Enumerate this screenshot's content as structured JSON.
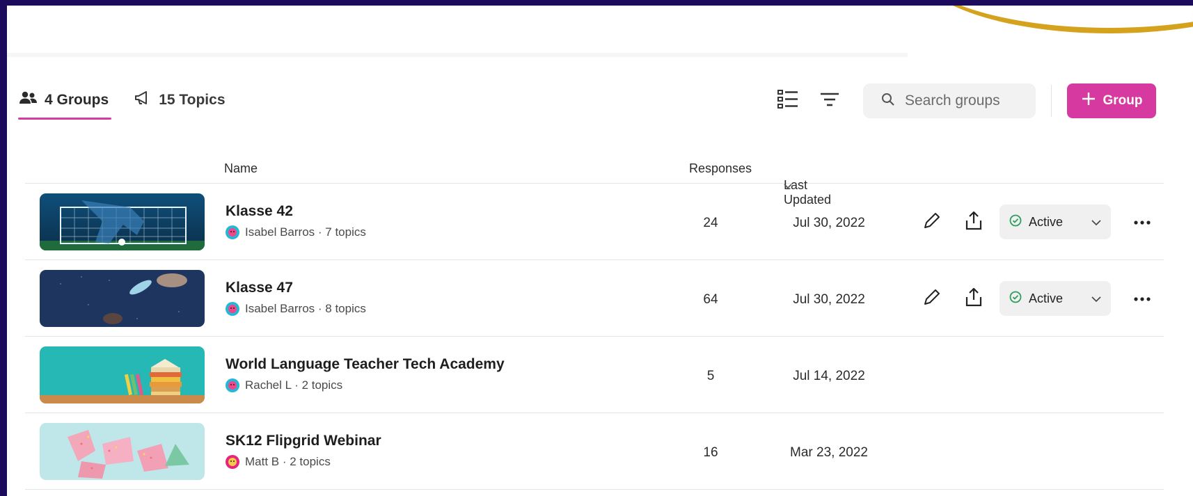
{
  "tabs": [
    {
      "label": "4 Groups",
      "icon": "users-icon",
      "active": true
    },
    {
      "label": "15 Topics",
      "icon": "megaphone-icon",
      "active": false
    }
  ],
  "toolbar": {
    "search_placeholder": "Search groups",
    "add_label": "Group"
  },
  "table": {
    "columns": [
      "Name",
      "Responses",
      "Last Updated"
    ],
    "sort_column": "Last Updated",
    "rows": [
      {
        "title": "Klasse 42",
        "owner": "Isabel Barros",
        "topics": "7 topics",
        "subtitle": "Isabel Barros · 7 topics",
        "responses": "24",
        "updated": "Jul 30, 2022",
        "status": "Active",
        "show_actions": true
      },
      {
        "title": "Klasse 47",
        "owner": "Isabel Barros",
        "topics": "8 topics",
        "subtitle": "Isabel Barros · 8 topics",
        "responses": "64",
        "updated": "Jul 30, 2022",
        "status": "Active",
        "show_actions": true
      },
      {
        "title": "World Language Teacher Tech Academy",
        "owner": "Rachel L",
        "topics": "2 topics",
        "subtitle": "Rachel L · 2 topics",
        "responses": "5",
        "updated": "Jul 14, 2022",
        "show_actions": false
      },
      {
        "title": "SK12 Flipgrid Webinar",
        "owner": "Matt B",
        "topics": "2 topics",
        "subtitle": "Matt B · 2 topics",
        "responses": "16",
        "updated": "Mar 23, 2022",
        "show_actions": false
      }
    ]
  },
  "colors": {
    "accent": "#d63aa0",
    "background": "#1c0a5c",
    "status_green": "#2e9e5b"
  }
}
